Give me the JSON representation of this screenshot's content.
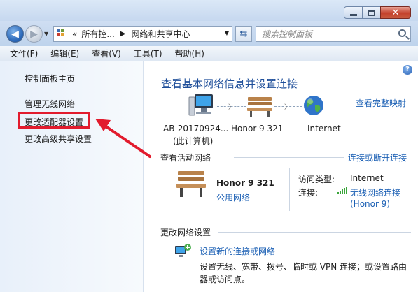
{
  "address": {
    "overflow": "«",
    "crumb1": "所有控...",
    "crumb2": "网络和共享中心"
  },
  "search": {
    "placeholder": "搜索控制面板"
  },
  "menu": [
    "文件(F)",
    "编辑(E)",
    "查看(V)",
    "工具(T)",
    "帮助(H)"
  ],
  "sidebar": {
    "items": [
      {
        "label": "控制面板主页"
      },
      {
        "label": "管理无线网络"
      },
      {
        "label": "更改适配器设置"
      },
      {
        "label": "更改高级共享设置"
      }
    ]
  },
  "main": {
    "title": "查看基本网络信息并设置连接",
    "view_full_map": "查看完整映射",
    "nodes": {
      "computer_name": "AB-20170924...",
      "computer_sub": "(此计算机)",
      "network_name": "Honor 9  321",
      "internet": "Internet"
    },
    "active": {
      "heading": "查看活动网络",
      "connect_link": "连接或断开连接",
      "network_name": "Honor 9  321",
      "network_type": "公用网络",
      "access_label": "访问类型:",
      "access_value": "Internet",
      "conn_label": "连接:",
      "conn_value": "无线网络连接",
      "conn_value2": "(Honor 9)"
    },
    "change": {
      "heading": "更改网络设置",
      "setup_link": "设置新的连接或网络",
      "setup_desc1": "设置无线、宽带、拨号、临时或 VPN 连接；或设置路由",
      "setup_desc2": "器或访问点。"
    }
  },
  "colors": {
    "highlight": "#e21b2d",
    "link": "#1a5fb4",
    "title": "#1f4f9a"
  }
}
